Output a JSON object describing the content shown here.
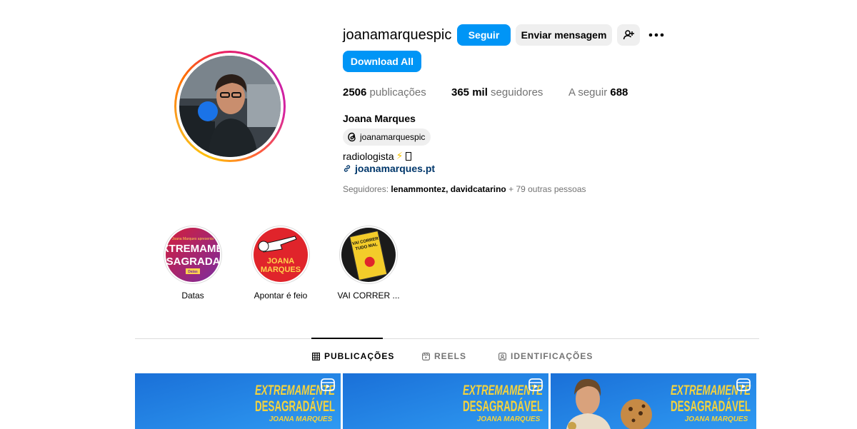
{
  "profile": {
    "username": "joanamarquespic",
    "follow_label": "Seguir",
    "message_label": "Enviar mensagem",
    "download_label": "Download All",
    "full_name": "Joana Marques",
    "threads_handle": "joanamarquespic",
    "bio_text": "radiologista",
    "link_text": "joanamarques.pt"
  },
  "stats": {
    "posts_count": "2506",
    "posts_label": "publicações",
    "followers_count": "365 mil",
    "followers_label": "seguidores",
    "following_label": "A seguir",
    "following_count": "688"
  },
  "followed_by": {
    "prefix": "Seguidores:",
    "names": "lenammontez, davidcatarino",
    "suffix": "+ 79 outras pessoas"
  },
  "highlights": [
    {
      "label": "Datas"
    },
    {
      "label": "Apontar é feio"
    },
    {
      "label": "VAI CORRER ..."
    }
  ],
  "tabs": [
    {
      "label": "PUBLICAÇÕES",
      "icon": "grid-icon",
      "active": true
    },
    {
      "label": "REELS",
      "icon": "reels-icon",
      "active": false
    },
    {
      "label": "IDENTIFICAÇÕES",
      "icon": "tagged-icon",
      "active": false
    }
  ],
  "posts": [
    {
      "line1": "EXTREMAMENTE",
      "line2": "DESAGRADÁVEL",
      "line3": "JOANA MARQUES"
    },
    {
      "line1": "EXTREMAMENTE",
      "line2": "DESAGRADÁVEL",
      "line3": "JOANA MARQUES"
    },
    {
      "line1": "EXTREMAMENTE",
      "line2": "DESAGRADÁVEL",
      "line3": "JOANA MARQUES"
    }
  ],
  "highlight_art": {
    "datas_top": "Joana Marques apresenta",
    "datas_line1": "EXTREMAMEN",
    "datas_line2": "ESAGRADAV",
    "datas_tag": "Datas",
    "apontar_line1": "JOANA",
    "apontar_line2": "MARQUES",
    "vai_line1": "VAI CORRER",
    "vai_line2": "TUDO MAL"
  },
  "colors": {
    "primary_blue": "#0095f6",
    "link_blue": "#00376b",
    "secondary_gray": "#737373",
    "post_blue": "#1f7fe0",
    "post_yellow": "#f5d33c"
  }
}
